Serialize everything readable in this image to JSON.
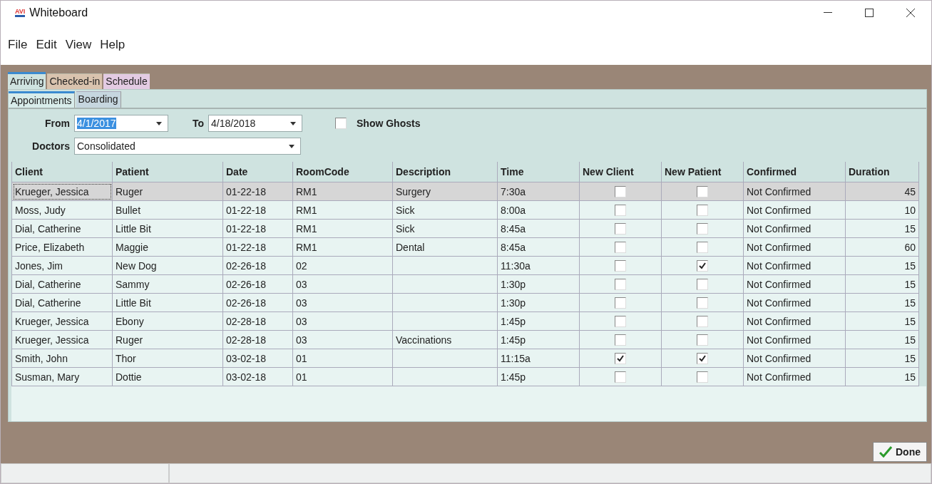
{
  "window": {
    "title": "Whiteboard",
    "logo": "AVI"
  },
  "menu": [
    "File",
    "Edit",
    "View",
    "Help"
  ],
  "tabs": [
    {
      "label": "Arriving",
      "selected": true,
      "color": "#cfe3e0"
    },
    {
      "label": "Checked-in",
      "selected": false,
      "color": "#d9c3ae"
    },
    {
      "label": "Schedule",
      "selected": false,
      "color": "#e3cbe3"
    }
  ],
  "subtabs": [
    {
      "label": "Appointments",
      "selected": true
    },
    {
      "label": "Boarding",
      "selected": false
    }
  ],
  "filters": {
    "from_label": "From",
    "from_value": "4/1/2017",
    "to_label": "To",
    "to_value": "4/18/2018",
    "show_ghosts": {
      "label": "Show Ghosts",
      "checked": false
    },
    "doctors_label": "Doctors",
    "doctors_value": "Consolidated"
  },
  "table": {
    "columns": [
      "Client",
      "Patient",
      "Date",
      "RoomCode",
      "Description",
      "Time",
      "New Client",
      "New Patient",
      "Confirmed",
      "Duration"
    ],
    "rows": [
      {
        "client": "Krueger, Jessica",
        "patient": "Ruger",
        "date": "01-22-18",
        "room": "RM1",
        "description": "Surgery",
        "time": "7:30a",
        "new_client": false,
        "new_patient": false,
        "confirmed": "Not Confirmed",
        "duration": "45",
        "selected": true
      },
      {
        "client": "Moss, Judy",
        "patient": "Bullet",
        "date": "01-22-18",
        "room": "RM1",
        "description": "Sick",
        "time": "8:00a",
        "new_client": false,
        "new_patient": false,
        "confirmed": "Not Confirmed",
        "duration": "10",
        "selected": false
      },
      {
        "client": "Dial, Catherine",
        "patient": "Little Bit",
        "date": "01-22-18",
        "room": "RM1",
        "description": "Sick",
        "time": "8:45a",
        "new_client": false,
        "new_patient": false,
        "confirmed": "Not Confirmed",
        "duration": "15",
        "selected": false
      },
      {
        "client": "Price, Elizabeth",
        "patient": "Maggie",
        "date": "01-22-18",
        "room": "RM1",
        "description": "Dental",
        "time": "8:45a",
        "new_client": false,
        "new_patient": false,
        "confirmed": "Not Confirmed",
        "duration": "60",
        "selected": false
      },
      {
        "client": "Jones, Jim",
        "patient": "New Dog",
        "date": "02-26-18",
        "room": "02",
        "description": "",
        "time": "11:30a",
        "new_client": false,
        "new_patient": true,
        "confirmed": "Not Confirmed",
        "duration": "15",
        "selected": false
      },
      {
        "client": "Dial, Catherine",
        "patient": "Sammy",
        "date": "02-26-18",
        "room": "03",
        "description": "",
        "time": "1:30p",
        "new_client": false,
        "new_patient": false,
        "confirmed": "Not Confirmed",
        "duration": "15",
        "selected": false
      },
      {
        "client": "Dial, Catherine",
        "patient": "Little Bit",
        "date": "02-26-18",
        "room": "03",
        "description": "",
        "time": "1:30p",
        "new_client": false,
        "new_patient": false,
        "confirmed": "Not Confirmed",
        "duration": "15",
        "selected": false
      },
      {
        "client": "Krueger, Jessica",
        "patient": "Ebony",
        "date": "02-28-18",
        "room": "03",
        "description": "",
        "time": "1:45p",
        "new_client": false,
        "new_patient": false,
        "confirmed": "Not Confirmed",
        "duration": "15",
        "selected": false
      },
      {
        "client": "Krueger, Jessica",
        "patient": "Ruger",
        "date": "02-28-18",
        "room": "03",
        "description": "Vaccinations",
        "time": "1:45p",
        "new_client": false,
        "new_patient": false,
        "confirmed": "Not Confirmed",
        "duration": "15",
        "selected": false
      },
      {
        "client": "Smith, John",
        "patient": "Thor",
        "date": "03-02-18",
        "room": "01",
        "description": "",
        "time": "11:15a",
        "new_client": true,
        "new_patient": true,
        "confirmed": "Not Confirmed",
        "duration": "15",
        "selected": false
      },
      {
        "client": "Susman, Mary",
        "patient": "Dottie",
        "date": "03-02-18",
        "room": "01",
        "description": "",
        "time": "1:45p",
        "new_client": false,
        "new_patient": false,
        "confirmed": "Not Confirmed",
        "duration": "15",
        "selected": false
      }
    ]
  },
  "done_button": "Done"
}
